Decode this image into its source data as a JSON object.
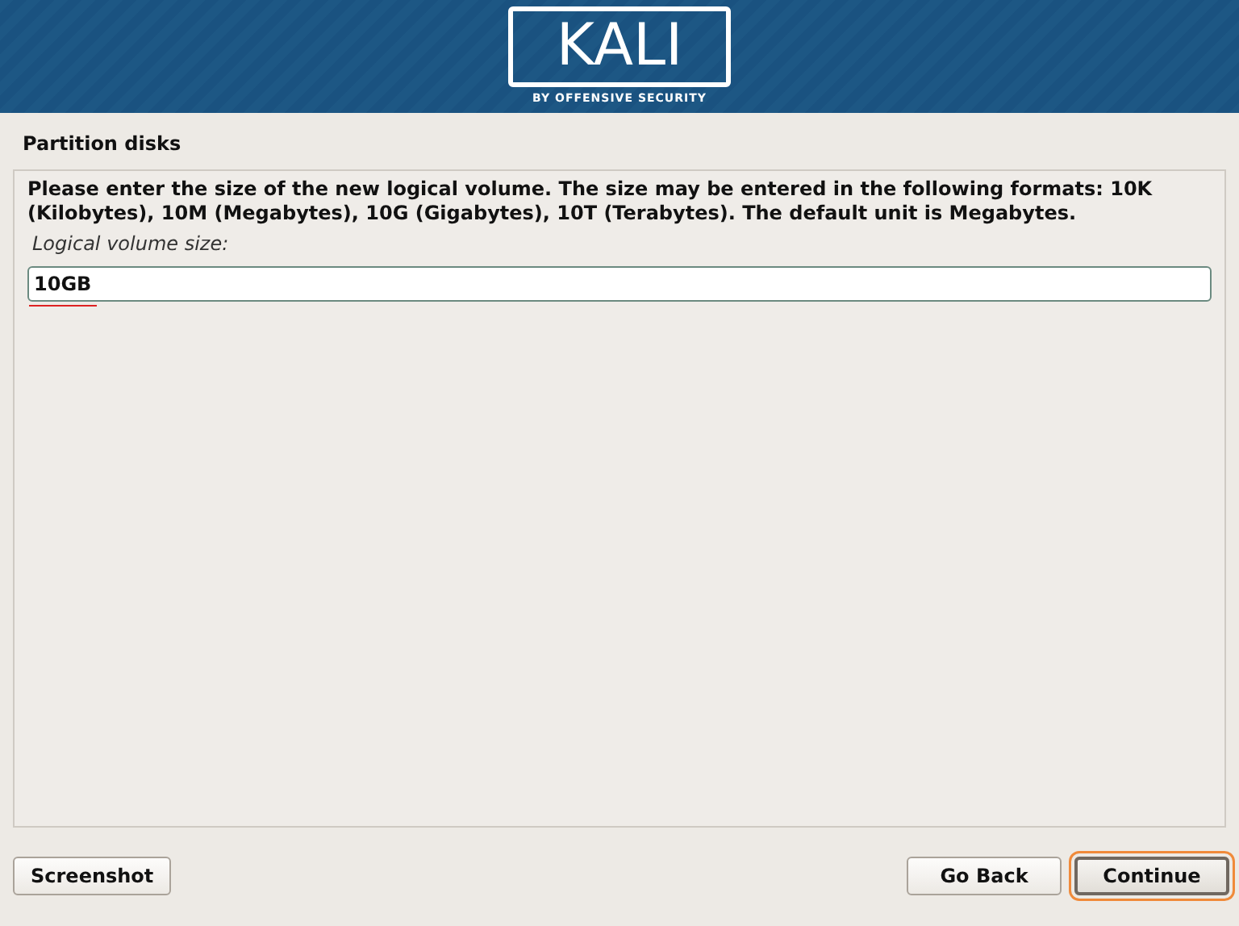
{
  "header": {
    "logo_text": "KALI",
    "tagline": "BY OFFENSIVE SECURITY"
  },
  "title": "Partition disks",
  "description": "Please enter the size of the new logical volume. The size may be entered in the following formats: 10K (Kilobytes), 10M (Megabytes), 10G (Gigabytes), 10T (Terabytes). The default unit is Megabytes.",
  "field": {
    "label": "Logical volume size:",
    "value": "10GB",
    "misspelled": true
  },
  "left_buttons": [
    {
      "label": "Screenshot",
      "focused": false
    }
  ],
  "right_buttons": [
    {
      "label": "Go Back",
      "focused": false
    },
    {
      "label": "Continue",
      "focused": true
    }
  ]
}
